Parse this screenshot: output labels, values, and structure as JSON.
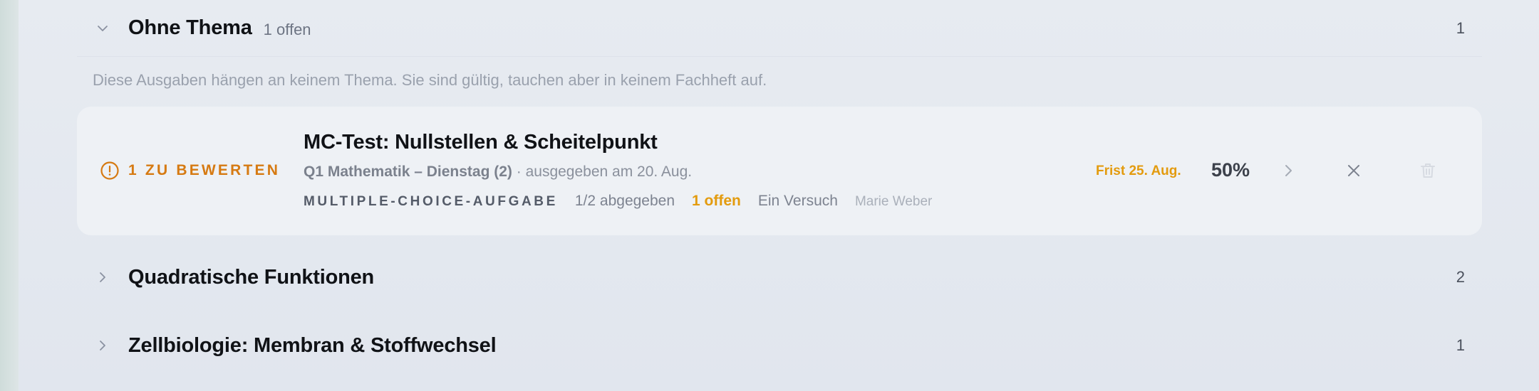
{
  "groups": [
    {
      "title": "Ohne Thema",
      "subtitle": "1 offen",
      "count": "1",
      "expanded": true,
      "description": "Diese Ausgaben hängen an keinem Thema. Sie sind gültig, tauchen aber in keinem Fachheft auf."
    },
    {
      "title": "Quadratische Funktionen",
      "count": "2",
      "expanded": false
    },
    {
      "title": "Zellbiologie: Membran & Stoffwechsel",
      "count": "1",
      "expanded": false
    }
  ],
  "assignment": {
    "status": "1 ZU BEWERTEN",
    "status_icon": "alert-circle-icon",
    "title": "MC-Test: Nullstellen & Scheitelpunkt",
    "course": "Q1 Mathematik – Dienstag (2)",
    "issued": " · ausgegeben am 20. Aug.",
    "type": "MULTIPLE-CHOICE-AUFGABE",
    "submitted": "1/2 abgegeben",
    "open": "1 offen",
    "attempts": "Ein Versuch",
    "author": "Marie Weber",
    "deadline": "Frist 25. Aug.",
    "percent": "50%"
  },
  "colors": {
    "accent_orange": "#d67a12",
    "warning_yellow": "#e39b0e",
    "card_bg": "#eef1f5",
    "page_bg": "#e3e7ee"
  }
}
